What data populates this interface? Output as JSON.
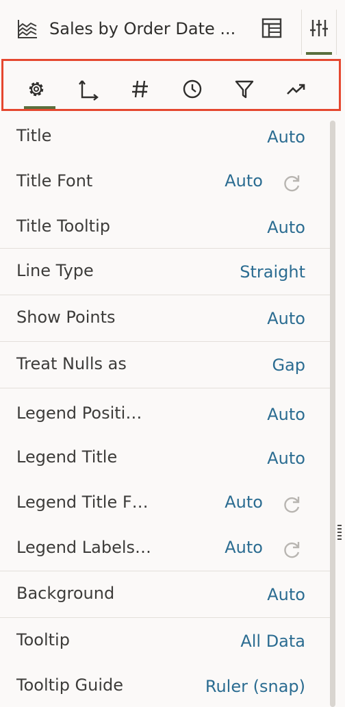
{
  "header": {
    "title": "Sales by Order Date ...",
    "viz_icon": "line-chart-icon",
    "layout_icon": "layout-icon",
    "properties_icon": "sliders-icon"
  },
  "tabs": [
    {
      "icon": "gear-icon",
      "active": true
    },
    {
      "icon": "axis-icon",
      "active": false
    },
    {
      "icon": "hash-icon",
      "active": false
    },
    {
      "icon": "clock-icon",
      "active": false
    },
    {
      "icon": "filter-icon",
      "active": false
    },
    {
      "icon": "trend-icon",
      "active": false
    }
  ],
  "properties": [
    {
      "label": "Title",
      "value": "Auto"
    },
    {
      "label": "Title Font",
      "value": "Auto",
      "reset_icon": "reset-icon"
    },
    {
      "label": "Title Tooltip",
      "value": "Auto"
    },
    {
      "label": "Line Type",
      "value": "Straight"
    },
    {
      "label": "Show Points",
      "value": "Auto"
    },
    {
      "label": "Treat Nulls as",
      "value": "Gap"
    },
    {
      "label": "Legend Positi…",
      "value": "Auto"
    },
    {
      "label": "Legend Title",
      "value": "Auto"
    },
    {
      "label": "Legend Title F…",
      "value": "Auto",
      "reset_icon": "reset-icon"
    },
    {
      "label": "Legend Labels…",
      "value": "Auto",
      "reset_icon": "reset-icon"
    },
    {
      "label": "Background",
      "value": "Auto"
    },
    {
      "label": "Tooltip",
      "value": "All Data"
    },
    {
      "label": "Tooltip Guide",
      "value": "Ruler (snap)"
    }
  ],
  "colors": {
    "accent": "#5a6f3e",
    "value_text": "#2b6c91",
    "highlight_border": "#e5472f"
  }
}
